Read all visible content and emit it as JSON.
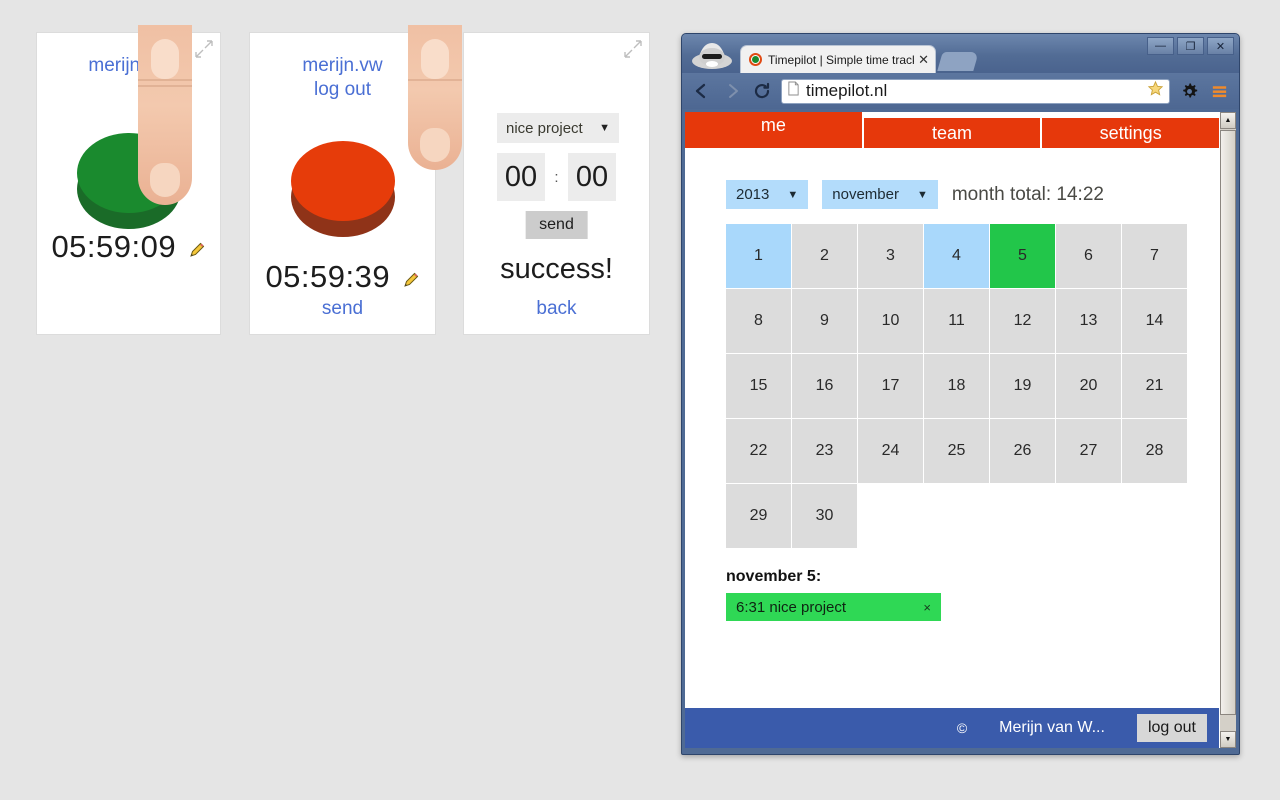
{
  "panels": [
    {
      "id": "panel-running",
      "expand_icon": "expand-icon",
      "user": "merijn.vw",
      "button_state": "running-green",
      "timer": "05:59:09",
      "edit_icon": "pencil-icon"
    },
    {
      "id": "panel-stopped",
      "expand_icon": "expand-icon",
      "user": "merijn.vw",
      "logout_label": "log out",
      "button_state": "stopped-red",
      "timer": "05:59:39",
      "edit_icon": "pencil-icon",
      "send_label": "send"
    },
    {
      "id": "panel-success",
      "expand_icon": "expand-icon",
      "project_select": "nice project",
      "hours_value": "00",
      "time_separator": ":",
      "minutes_value": "00",
      "send_label": "send",
      "success_label": "success!",
      "back_label": "back"
    }
  ],
  "browser": {
    "incognito_icon": "incognito-icon",
    "window_buttons": {
      "minimize": "—",
      "maximize": "❐",
      "close": "✕"
    },
    "tab": {
      "favicon": "timepilot-favicon",
      "title": "Timepilot | Simple time trackin",
      "close": "✕"
    },
    "toolbar": {
      "back_icon": "back-arrow-icon",
      "forward_icon": "forward-arrow-icon",
      "reload_icon": "reload-icon",
      "page_icon": "page-icon",
      "url": "timepilot.nl",
      "bookmark_icon": "star-icon",
      "settings_icon": "gear-icon",
      "menu_icon": "hamburger-menu-icon"
    },
    "scrollbar": {
      "up": "▲",
      "down": "▼"
    }
  },
  "page": {
    "nav_tabs": [
      {
        "label": "me",
        "active": true
      },
      {
        "label": "team",
        "active": false
      },
      {
        "label": "settings",
        "active": false
      }
    ],
    "controls": {
      "year": "2013",
      "month": "november",
      "caret": "▼",
      "month_total": "month total: 14:22"
    },
    "calendar": {
      "days": [
        {
          "n": "1",
          "state": "blue"
        },
        {
          "n": "2",
          "state": "normal"
        },
        {
          "n": "3",
          "state": "normal"
        },
        {
          "n": "4",
          "state": "blue"
        },
        {
          "n": "5",
          "state": "green"
        },
        {
          "n": "6",
          "state": "normal"
        },
        {
          "n": "7",
          "state": "normal"
        },
        {
          "n": "8",
          "state": "normal"
        },
        {
          "n": "9",
          "state": "normal"
        },
        {
          "n": "10",
          "state": "normal"
        },
        {
          "n": "11",
          "state": "normal"
        },
        {
          "n": "12",
          "state": "normal"
        },
        {
          "n": "13",
          "state": "normal"
        },
        {
          "n": "14",
          "state": "normal"
        },
        {
          "n": "15",
          "state": "normal"
        },
        {
          "n": "16",
          "state": "normal"
        },
        {
          "n": "17",
          "state": "normal"
        },
        {
          "n": "18",
          "state": "normal"
        },
        {
          "n": "19",
          "state": "normal"
        },
        {
          "n": "20",
          "state": "normal"
        },
        {
          "n": "21",
          "state": "normal"
        },
        {
          "n": "22",
          "state": "normal"
        },
        {
          "n": "23",
          "state": "normal"
        },
        {
          "n": "24",
          "state": "normal"
        },
        {
          "n": "25",
          "state": "normal"
        },
        {
          "n": "26",
          "state": "normal"
        },
        {
          "n": "27",
          "state": "normal"
        },
        {
          "n": "28",
          "state": "normal"
        },
        {
          "n": "29",
          "state": "normal"
        },
        {
          "n": "30",
          "state": "normal"
        }
      ]
    },
    "entries": {
      "title": "november 5:",
      "items": [
        {
          "text": "6:31 nice project",
          "remove": "×"
        }
      ]
    },
    "footer": {
      "copyright": "©",
      "author": "Merijn van W...",
      "logout_label": "log out"
    }
  },
  "colors": {
    "accent_orange": "#e6380b",
    "button_green": "#1a8a2e",
    "button_red": "#e63c0a",
    "footer_blue": "#3a5bab",
    "day_blue": "#a9d8fb",
    "day_green": "#22c64a"
  }
}
